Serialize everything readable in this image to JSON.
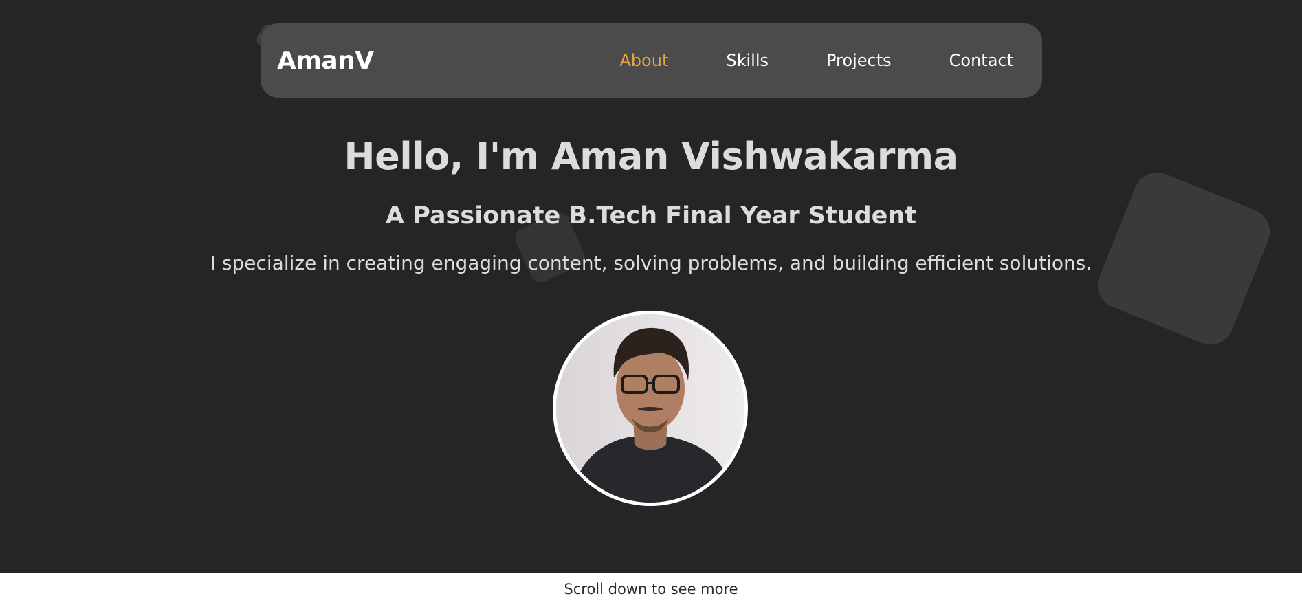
{
  "nav": {
    "logo": "AmanV",
    "links": [
      {
        "label": "About",
        "active": true
      },
      {
        "label": "Skills",
        "active": false
      },
      {
        "label": "Projects",
        "active": false
      },
      {
        "label": "Contact",
        "active": false
      }
    ]
  },
  "hero": {
    "title": "Hello, I'm Aman Vishwakarma",
    "subtitle": "A Passionate B.Tech Final Year Student",
    "tagline": "I specialize in creating engaging content, solving problems, and building efficient solutions."
  },
  "footer": {
    "text": "Scroll down to see more"
  },
  "colors": {
    "background": "#252527",
    "navbar": "#4b4b4d",
    "accent": "#e3a63e",
    "text": "#dcdcdc"
  }
}
